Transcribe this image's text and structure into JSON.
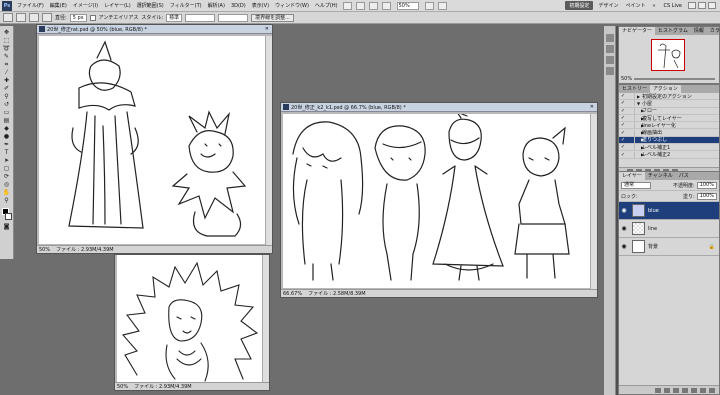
{
  "menubar": {
    "logo": "Ps",
    "items": [
      "ファイル(F)",
      "編集(E)",
      "イメージ(I)",
      "レイヤー(L)",
      "選択範囲(S)",
      "フィルター(T)",
      "解析(A)",
      "3D(D)",
      "表示(V)",
      "ウィンドウ(W)",
      "ヘルプ(H)"
    ],
    "zoom": "50%",
    "workspace_active": "初期設定",
    "workspaces": [
      "デザイン",
      "ペイント"
    ],
    "more": "»",
    "cs_live": "CS Live"
  },
  "options": {
    "size_label": "直径:",
    "size_value": "5 px",
    "antialias_label": "アンチエイリアス",
    "style_label": "スタイル:",
    "style_value": "標準",
    "refine_button": "境界線を調整..."
  },
  "documents": [
    {
      "title": "20世_修正rat.psd @ 50% (blue, RGB/8) *",
      "zoom": "50%",
      "status": "ファイル : 2.93M/4.39M"
    },
    {
      "title": "20世_修正_k1.psd @ 50% (blue, RGB/8) *",
      "zoom": "50%",
      "status": "ファイル : 2.93M/4.39M"
    },
    {
      "title": "20世_修正_k2_k1.psd @ 66.7% (blue, RGB/8) *",
      "zoom": "66.67%",
      "status": "ファイル : 2.58M/8.39M"
    }
  ],
  "panels": {
    "navigator_tabs": [
      "ナビゲーター",
      "ヒストグラム",
      "情報",
      "カラー"
    ],
    "navigator_zoom": "50%",
    "actions_tabs": [
      "ヒストリー",
      "アクション"
    ],
    "actions": [
      {
        "label": "初期設定のアクション",
        "level": 0,
        "selected": false
      },
      {
        "label": "小屋",
        "level": 0,
        "selected": false
      },
      {
        "label": "フロー",
        "level": 1,
        "selected": false
      },
      {
        "label": "複写してレイヤー",
        "level": 1,
        "selected": false
      },
      {
        "label": "lineレイヤー化",
        "level": 1,
        "selected": false
      },
      {
        "label": "線画抽出",
        "level": 1,
        "selected": false
      },
      {
        "label": "塗りつぶし",
        "level": 1,
        "selected": true
      },
      {
        "label": "レベル補正1",
        "level": 1,
        "selected": false
      },
      {
        "label": "レベル補正2",
        "level": 1,
        "selected": false
      }
    ],
    "layers_tabs": [
      "レイヤー",
      "チャンネル",
      "パス"
    ],
    "blend_mode": "通常",
    "opacity_label": "不透明度:",
    "opacity_value": "100%",
    "lock_label": "ロック:",
    "fill_label": "塗り:",
    "fill_value": "100%",
    "layers": [
      {
        "name": "blue",
        "selected": true,
        "visible": true,
        "lock": ""
      },
      {
        "name": "line",
        "selected": false,
        "visible": true,
        "lock": ""
      },
      {
        "name": "背景",
        "selected": false,
        "visible": true,
        "lock": "🔒"
      }
    ]
  }
}
